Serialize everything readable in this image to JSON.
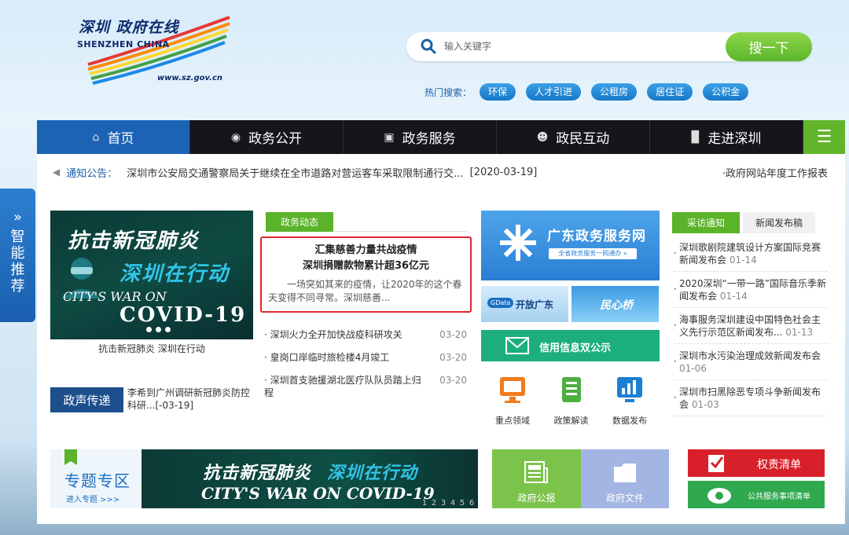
{
  "header": {
    "logo_cn": "深圳 政府在线",
    "logo_en": "SHENZHEN CHINA",
    "logo_url": "www.sz.gov.cn",
    "search_placeholder": "输入关键字",
    "search_button": "搜一下",
    "hot_label": "热门搜索：",
    "hot_tags": [
      "环保",
      "人才引进",
      "公租房",
      "居住证",
      "公积金"
    ]
  },
  "nav": {
    "items": [
      {
        "label": "首页",
        "icon": "home-icon"
      },
      {
        "label": "政务公开",
        "icon": "news-icon"
      },
      {
        "label": "政务服务",
        "icon": "monitor-icon"
      },
      {
        "label": "政民互动",
        "icon": "people-icon"
      },
      {
        "label": "走进深圳",
        "icon": "building-icon"
      }
    ],
    "menu_glyph": "☰"
  },
  "notice": {
    "label": "通知公告：",
    "text": "深圳市公安局交通警察局关于继续在全市道路对营运客车采取限制通行交...",
    "date": "[2020-03-19]",
    "right_link": "·政府网站年度工作报表"
  },
  "side": {
    "arrow": "»",
    "label": "智能推荐"
  },
  "banner": {
    "t1": "抗击新冠肺炎",
    "t2": "深圳在行动",
    "t3": "CITY'S WAR ON",
    "t4": "COVID-19",
    "caption": "抗击新冠肺炎 深圳在行动"
  },
  "voice": {
    "tag": "政声传递",
    "text": "李希到广州调研新冠肺炎防控科研...[-03-19]"
  },
  "gov_news": {
    "tab": "政务动态",
    "headline_1": "汇集慈善力量共战疫情",
    "headline_2": "深圳捐赠款物累计超36亿元",
    "summary": "一场突如其来的疫情，让2020年的这个春天变得不同寻常。深圳慈善...",
    "items": [
      {
        "title": "深圳火力全开加快战疫科研攻关",
        "date": "03-20"
      },
      {
        "title": "皇岗口岸临时旅检楼4月竣工",
        "date": "03-20"
      },
      {
        "title": "深圳首支驰援湖北医疗队队员踏上归程",
        "date": "03-20"
      }
    ]
  },
  "services": {
    "gd_title": "广东政务服务网",
    "gd_sub": "全省政务服务一网通办 »",
    "open_gd_badge": "GData",
    "open_gd": "开放广东",
    "minxin": "民心桥",
    "credit": "信用信息双公示",
    "icons": [
      {
        "label": "重点领域",
        "icon": "monitor-icon"
      },
      {
        "label": "政策解读",
        "icon": "document-icon"
      },
      {
        "label": "数据发布",
        "icon": "bar-chart-icon"
      }
    ]
  },
  "interview": {
    "tab_active": "采访通知",
    "tab_inactive": "新闻发布稿",
    "items": [
      {
        "title": "深圳歌剧院建筑设计方案国际竞赛新闻发布会",
        "date": "01-14"
      },
      {
        "title": "2020深圳“一带一路”国际音乐季新闻发布会",
        "date": "01-14"
      },
      {
        "title": "海事服务深圳建设中国特色社会主义先行示范区新闻发布...",
        "date": "01-13"
      },
      {
        "title": "深圳市水污染治理成效新闻发布会",
        "date": "01-06"
      },
      {
        "title": "深圳市扫黑除恶专项斗争新闻发布会",
        "date": "01-03"
      }
    ]
  },
  "bottom": {
    "topic_title": "专题专区",
    "topic_link": "进入专题 >>>",
    "bb_t1": "抗击新冠肺炎",
    "bb_t2": "深圳在行动",
    "bb_t3": "CITY'S WAR ON COVID-19",
    "pager": [
      "1",
      "2",
      "3",
      "4",
      "5",
      "6"
    ],
    "gov_pub": "政府公报",
    "gov_doc": "政府文件",
    "power_list": "权责清单",
    "service_list": "公共服务事项清单"
  },
  "colors": {
    "nav_active": "#1c63b6",
    "green": "#5bb32a",
    "highlight_border": "#e0262a",
    "power_red": "#d8202a"
  }
}
